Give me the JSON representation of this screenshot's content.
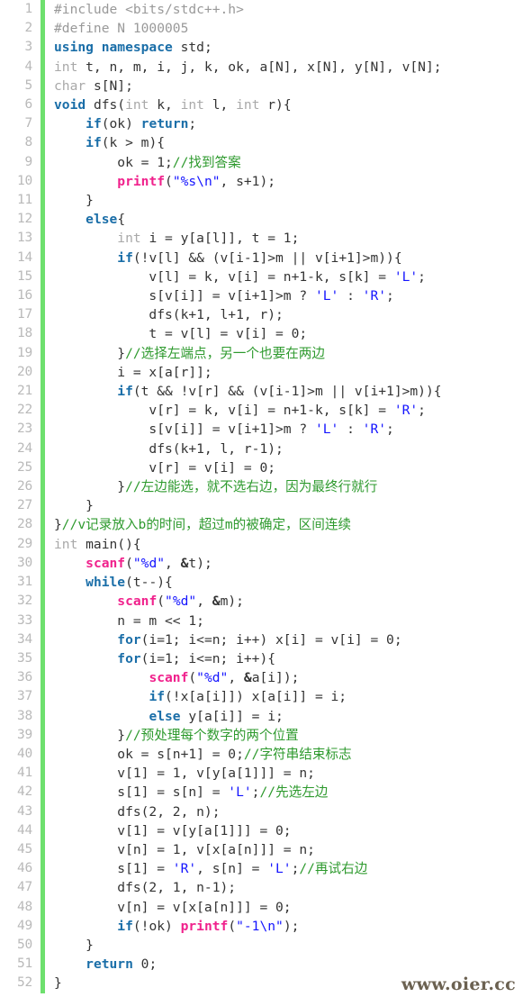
{
  "editor": {
    "language": "cpp",
    "gutter_accent_color": "#6ee06e",
    "background_color": "#ffffff",
    "line_number_color": "#b9b9b9",
    "first_line": 1,
    "last_line": 52,
    "total_lines": 52
  },
  "theme": {
    "plain": "#333333",
    "keyword": "#1a6ea8",
    "type": "#a9a9a9",
    "preprocessor": "#999999",
    "function": "#f0218c",
    "string": "#1414ff",
    "character": "#1414ff",
    "comment": "#2e9a2e"
  },
  "watermark": {
    "text": "www.oier.cc",
    "color": "#6b6151"
  },
  "lines": [
    {
      "n": "1",
      "tokens": [
        {
          "t": "pre",
          "s": "#include <bits/stdc++.h>"
        }
      ]
    },
    {
      "n": "2",
      "tokens": [
        {
          "t": "pre",
          "s": "#define N 1000005"
        }
      ]
    },
    {
      "n": "3",
      "tokens": [
        {
          "t": "kw",
          "s": "using namespace"
        },
        {
          "t": "plain",
          "s": " std;"
        }
      ]
    },
    {
      "n": "4",
      "tokens": [
        {
          "t": "type",
          "s": "int"
        },
        {
          "t": "plain",
          "s": " t, n, m, i, j, k, ok, a[N], x[N], y[N], v[N];"
        }
      ]
    },
    {
      "n": "5",
      "tokens": [
        {
          "t": "type",
          "s": "char"
        },
        {
          "t": "plain",
          "s": " s[N];"
        }
      ]
    },
    {
      "n": "6",
      "tokens": [
        {
          "t": "kw",
          "s": "void"
        },
        {
          "t": "plain",
          "s": " dfs("
        },
        {
          "t": "type",
          "s": "int"
        },
        {
          "t": "plain",
          "s": " k, "
        },
        {
          "t": "type",
          "s": "int"
        },
        {
          "t": "plain",
          "s": " l, "
        },
        {
          "t": "type",
          "s": "int"
        },
        {
          "t": "plain",
          "s": " r){"
        }
      ]
    },
    {
      "n": "7",
      "tokens": [
        {
          "t": "plain",
          "s": "    "
        },
        {
          "t": "kw",
          "s": "if"
        },
        {
          "t": "plain",
          "s": "(ok) "
        },
        {
          "t": "kw",
          "s": "return"
        },
        {
          "t": "plain",
          "s": ";"
        }
      ]
    },
    {
      "n": "8",
      "tokens": [
        {
          "t": "plain",
          "s": "    "
        },
        {
          "t": "kw",
          "s": "if"
        },
        {
          "t": "plain",
          "s": "(k > m){"
        }
      ]
    },
    {
      "n": "9",
      "tokens": [
        {
          "t": "plain",
          "s": "        ok = 1;"
        },
        {
          "t": "com",
          "s": "//找到答案"
        }
      ]
    },
    {
      "n": "10",
      "tokens": [
        {
          "t": "plain",
          "s": "        "
        },
        {
          "t": "fn",
          "s": "printf"
        },
        {
          "t": "plain",
          "s": "("
        },
        {
          "t": "str",
          "s": "\"%s\\n\""
        },
        {
          "t": "plain",
          "s": ", s+1);"
        }
      ]
    },
    {
      "n": "11",
      "tokens": [
        {
          "t": "plain",
          "s": "    }"
        }
      ]
    },
    {
      "n": "12",
      "tokens": [
        {
          "t": "plain",
          "s": "    "
        },
        {
          "t": "kw",
          "s": "else"
        },
        {
          "t": "plain",
          "s": "{"
        }
      ]
    },
    {
      "n": "13",
      "tokens": [
        {
          "t": "plain",
          "s": "        "
        },
        {
          "t": "type",
          "s": "int"
        },
        {
          "t": "plain",
          "s": " i = y[a[l]], t = 1;"
        }
      ]
    },
    {
      "n": "14",
      "tokens": [
        {
          "t": "plain",
          "s": "        "
        },
        {
          "t": "kw",
          "s": "if"
        },
        {
          "t": "plain",
          "s": "(!v[l] && (v[i-1]>m || v[i+1]>m)){"
        }
      ]
    },
    {
      "n": "15",
      "tokens": [
        {
          "t": "plain",
          "s": "            v[l] = k, v[i] = n+1-k, s[k] = "
        },
        {
          "t": "chr",
          "s": "'L'"
        },
        {
          "t": "plain",
          "s": ";"
        }
      ]
    },
    {
      "n": "16",
      "tokens": [
        {
          "t": "plain",
          "s": "            s[v[i]] = v[i+1]>m ? "
        },
        {
          "t": "chr",
          "s": "'L'"
        },
        {
          "t": "plain",
          "s": " : "
        },
        {
          "t": "chr",
          "s": "'R'"
        },
        {
          "t": "plain",
          "s": ";"
        }
      ]
    },
    {
      "n": "17",
      "tokens": [
        {
          "t": "plain",
          "s": "            dfs(k+1, l+1, r);"
        }
      ]
    },
    {
      "n": "18",
      "tokens": [
        {
          "t": "plain",
          "s": "            t = v[l] = v[i] = 0;"
        }
      ]
    },
    {
      "n": "19",
      "tokens": [
        {
          "t": "plain",
          "s": "        }"
        },
        {
          "t": "com",
          "s": "//选择左端点，另一个也要在两边"
        }
      ]
    },
    {
      "n": "20",
      "tokens": [
        {
          "t": "plain",
          "s": "        i = x[a[r]];"
        }
      ]
    },
    {
      "n": "21",
      "tokens": [
        {
          "t": "plain",
          "s": "        "
        },
        {
          "t": "kw",
          "s": "if"
        },
        {
          "t": "plain",
          "s": "(t && !v[r] && (v[i-1]>m || v[i+1]>m)){"
        }
      ]
    },
    {
      "n": "22",
      "tokens": [
        {
          "t": "plain",
          "s": "            v[r] = k, v[i] = n+1-k, s[k] = "
        },
        {
          "t": "chr",
          "s": "'R'"
        },
        {
          "t": "plain",
          "s": ";"
        }
      ]
    },
    {
      "n": "23",
      "tokens": [
        {
          "t": "plain",
          "s": "            s[v[i]] = v[i+1]>m ? "
        },
        {
          "t": "chr",
          "s": "'L'"
        },
        {
          "t": "plain",
          "s": " : "
        },
        {
          "t": "chr",
          "s": "'R'"
        },
        {
          "t": "plain",
          "s": ";"
        }
      ]
    },
    {
      "n": "24",
      "tokens": [
        {
          "t": "plain",
          "s": "            dfs(k+1, l, r-1);"
        }
      ]
    },
    {
      "n": "25",
      "tokens": [
        {
          "t": "plain",
          "s": "            v[r] = v[i] = 0;"
        }
      ]
    },
    {
      "n": "26",
      "tokens": [
        {
          "t": "plain",
          "s": "        }"
        },
        {
          "t": "com",
          "s": "//左边能选，就不选右边，因为最终行就行"
        }
      ]
    },
    {
      "n": "27",
      "tokens": [
        {
          "t": "plain",
          "s": "    }"
        }
      ]
    },
    {
      "n": "28",
      "tokens": [
        {
          "t": "plain",
          "s": "}"
        },
        {
          "t": "com",
          "s": "//v记录放入b的时间，超过m的被确定，区间连续"
        }
      ]
    },
    {
      "n": "29",
      "tokens": [
        {
          "t": "type",
          "s": "int"
        },
        {
          "t": "plain",
          "s": " main(){"
        }
      ]
    },
    {
      "n": "30",
      "tokens": [
        {
          "t": "plain",
          "s": "    "
        },
        {
          "t": "fn",
          "s": "scanf"
        },
        {
          "t": "plain",
          "s": "("
        },
        {
          "t": "str",
          "s": "\"%d\""
        },
        {
          "t": "plain",
          "s": ", "
        },
        {
          "t": "op",
          "s": "&"
        },
        {
          "t": "plain",
          "s": "t);"
        }
      ]
    },
    {
      "n": "31",
      "tokens": [
        {
          "t": "plain",
          "s": "    "
        },
        {
          "t": "kw",
          "s": "while"
        },
        {
          "t": "plain",
          "s": "(t--){"
        }
      ]
    },
    {
      "n": "32",
      "tokens": [
        {
          "t": "plain",
          "s": "        "
        },
        {
          "t": "fn",
          "s": "scanf"
        },
        {
          "t": "plain",
          "s": "("
        },
        {
          "t": "str",
          "s": "\"%d\""
        },
        {
          "t": "plain",
          "s": ", "
        },
        {
          "t": "op",
          "s": "&"
        },
        {
          "t": "plain",
          "s": "m);"
        }
      ]
    },
    {
      "n": "33",
      "tokens": [
        {
          "t": "plain",
          "s": "        n = m << 1;"
        }
      ]
    },
    {
      "n": "34",
      "tokens": [
        {
          "t": "plain",
          "s": "        "
        },
        {
          "t": "kw",
          "s": "for"
        },
        {
          "t": "plain",
          "s": "(i=1; i<=n; i++) x[i] = v[i] = 0;"
        }
      ]
    },
    {
      "n": "35",
      "tokens": [
        {
          "t": "plain",
          "s": "        "
        },
        {
          "t": "kw",
          "s": "for"
        },
        {
          "t": "plain",
          "s": "(i=1; i<=n; i++){"
        }
      ]
    },
    {
      "n": "36",
      "tokens": [
        {
          "t": "plain",
          "s": "            "
        },
        {
          "t": "fn",
          "s": "scanf"
        },
        {
          "t": "plain",
          "s": "("
        },
        {
          "t": "str",
          "s": "\"%d\""
        },
        {
          "t": "plain",
          "s": ", "
        },
        {
          "t": "op",
          "s": "&"
        },
        {
          "t": "plain",
          "s": "a[i]);"
        }
      ]
    },
    {
      "n": "37",
      "tokens": [
        {
          "t": "plain",
          "s": "            "
        },
        {
          "t": "kw",
          "s": "if"
        },
        {
          "t": "plain",
          "s": "(!x[a[i]]) x[a[i]] = i;"
        }
      ]
    },
    {
      "n": "38",
      "tokens": [
        {
          "t": "plain",
          "s": "            "
        },
        {
          "t": "kw",
          "s": "else"
        },
        {
          "t": "plain",
          "s": " y[a[i]] = i;"
        }
      ]
    },
    {
      "n": "39",
      "tokens": [
        {
          "t": "plain",
          "s": "        }"
        },
        {
          "t": "com",
          "s": "//预处理每个数字的两个位置"
        }
      ]
    },
    {
      "n": "40",
      "tokens": [
        {
          "t": "plain",
          "s": "        ok = s[n+1] = 0;"
        },
        {
          "t": "com",
          "s": "//字符串结束标志"
        }
      ]
    },
    {
      "n": "41",
      "tokens": [
        {
          "t": "plain",
          "s": "        v[1] = 1, v[y[a[1]]] = n;"
        }
      ]
    },
    {
      "n": "42",
      "tokens": [
        {
          "t": "plain",
          "s": "        s[1] = s[n] = "
        },
        {
          "t": "chr",
          "s": "'L'"
        },
        {
          "t": "plain",
          "s": ";"
        },
        {
          "t": "com",
          "s": "//先选左边"
        }
      ]
    },
    {
      "n": "43",
      "tokens": [
        {
          "t": "plain",
          "s": "        dfs(2, 2, n);"
        }
      ]
    },
    {
      "n": "44",
      "tokens": [
        {
          "t": "plain",
          "s": "        v[1] = v[y[a[1]]] = 0;"
        }
      ]
    },
    {
      "n": "45",
      "tokens": [
        {
          "t": "plain",
          "s": "        v[n] = 1, v[x[a[n]]] = n;"
        }
      ]
    },
    {
      "n": "46",
      "tokens": [
        {
          "t": "plain",
          "s": "        s[1] = "
        },
        {
          "t": "chr",
          "s": "'R'"
        },
        {
          "t": "plain",
          "s": ", s[n] = "
        },
        {
          "t": "chr",
          "s": "'L'"
        },
        {
          "t": "plain",
          "s": ";"
        },
        {
          "t": "com",
          "s": "//再试右边"
        }
      ]
    },
    {
      "n": "47",
      "tokens": [
        {
          "t": "plain",
          "s": "        dfs(2, 1, n-1);"
        }
      ]
    },
    {
      "n": "48",
      "tokens": [
        {
          "t": "plain",
          "s": "        v[n] = v[x[a[n]]] = 0;"
        }
      ]
    },
    {
      "n": "49",
      "tokens": [
        {
          "t": "plain",
          "s": "        "
        },
        {
          "t": "kw",
          "s": "if"
        },
        {
          "t": "plain",
          "s": "(!ok) "
        },
        {
          "t": "fn",
          "s": "printf"
        },
        {
          "t": "plain",
          "s": "("
        },
        {
          "t": "str",
          "s": "\"-1\\n\""
        },
        {
          "t": "plain",
          "s": ");"
        }
      ]
    },
    {
      "n": "50",
      "tokens": [
        {
          "t": "plain",
          "s": "    }"
        }
      ]
    },
    {
      "n": "51",
      "tokens": [
        {
          "t": "plain",
          "s": "    "
        },
        {
          "t": "kw",
          "s": "return"
        },
        {
          "t": "plain",
          "s": " 0;"
        }
      ]
    },
    {
      "n": "52",
      "tokens": [
        {
          "t": "plain",
          "s": "}"
        }
      ]
    }
  ]
}
